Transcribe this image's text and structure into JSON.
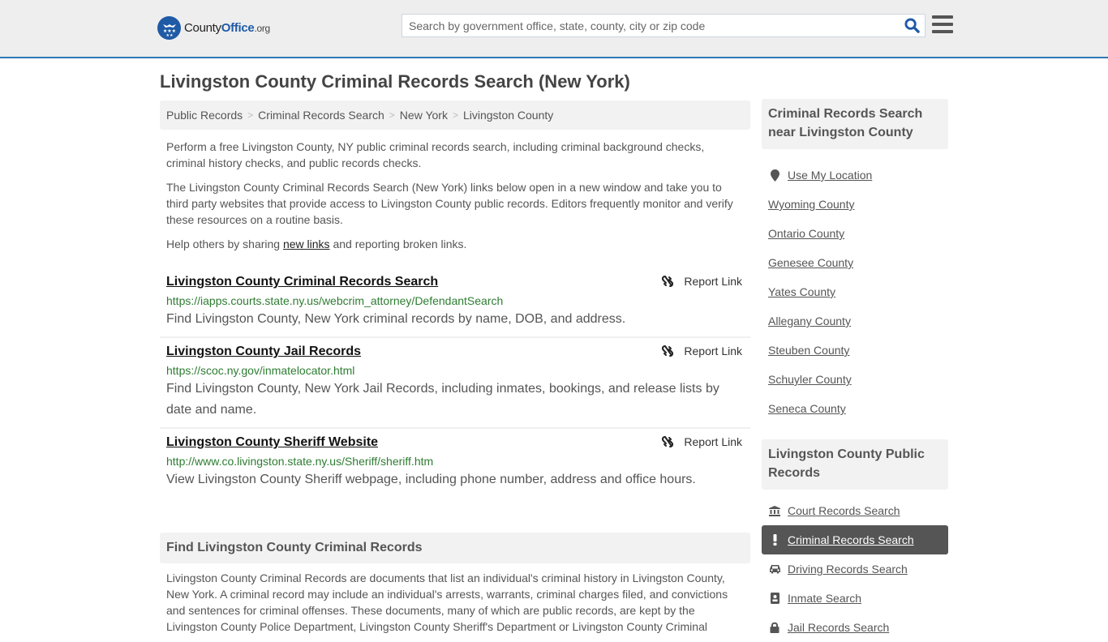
{
  "header": {
    "logo": {
      "name": "County",
      "office": "Office",
      "tld": ".org"
    },
    "search_placeholder": "Search by government office, state, county, city or zip code",
    "accent_color": "#2f78b7"
  },
  "page_title": "Livingston County Criminal Records Search (New York)",
  "breadcrumb": [
    "Public Records",
    "Criminal Records Search",
    "New York",
    "Livingston County"
  ],
  "intro": {
    "p1": "Perform a free Livingston County, NY public criminal records search, including criminal background checks, criminal history checks, and public records checks.",
    "p2": "The Livingston County Criminal Records Search (New York) links below open in a new window and take you to third party websites that provide access to Livingston County public records. Editors frequently monitor and verify these resources on a routine basis.",
    "p3_before": "Help others by sharing ",
    "p3_link": "new links",
    "p3_after": " and reporting broken links."
  },
  "links": [
    {
      "title": "Livingston County Criminal Records Search",
      "url": "https://iapps.courts.state.ny.us/webcrim_attorney/DefendantSearch",
      "description": "Find Livingston County, New York criminal records by name, DOB, and address.",
      "report_label": "Report Link"
    },
    {
      "title": "Livingston County Jail Records",
      "url": "https://scoc.ny.gov/inmatelocator.html",
      "description": "Find Livingston County, New York Jail Records, including inmates, bookings, and release lists by date and name.",
      "report_label": "Report Link"
    },
    {
      "title": "Livingston County Sheriff Website",
      "url": "http://www.co.livingston.state.ny.us/Sheriff/sheriff.htm",
      "description": "View Livingston County Sheriff webpage, including phone number, address and office hours.",
      "report_label": "Report Link"
    }
  ],
  "find_section": {
    "heading": "Find Livingston County Criminal Records",
    "body": "Livingston County Criminal Records are documents that list an individual's criminal history in Livingston County, New York. A criminal record may include an individual's arrests, warrants, criminal charges filed, and convictions and sentences for criminal offenses. These documents, many of which are public records, are kept by the Livingston County Police Department, Livingston County Sheriff's Department or Livingston County Criminal"
  },
  "sidebar": {
    "nearby": {
      "heading": "Criminal Records Search near Livingston County",
      "use_location": "Use My Location",
      "counties": [
        "Wyoming County",
        "Ontario County",
        "Genesee County",
        "Yates County",
        "Allegany County",
        "Steuben County",
        "Schuyler County",
        "Seneca County"
      ]
    },
    "public_records": {
      "heading": "Livingston County Public Records",
      "items": [
        {
          "label": "Court Records Search",
          "icon": "bank-icon",
          "active": false
        },
        {
          "label": "Criminal Records Search",
          "icon": "exclamation-icon",
          "active": true
        },
        {
          "label": "Driving Records Search",
          "icon": "car-icon",
          "active": false
        },
        {
          "label": "Inmate Search",
          "icon": "id-badge-icon",
          "active": false
        },
        {
          "label": "Jail Records Search",
          "icon": "lock-icon",
          "active": false
        }
      ]
    }
  }
}
